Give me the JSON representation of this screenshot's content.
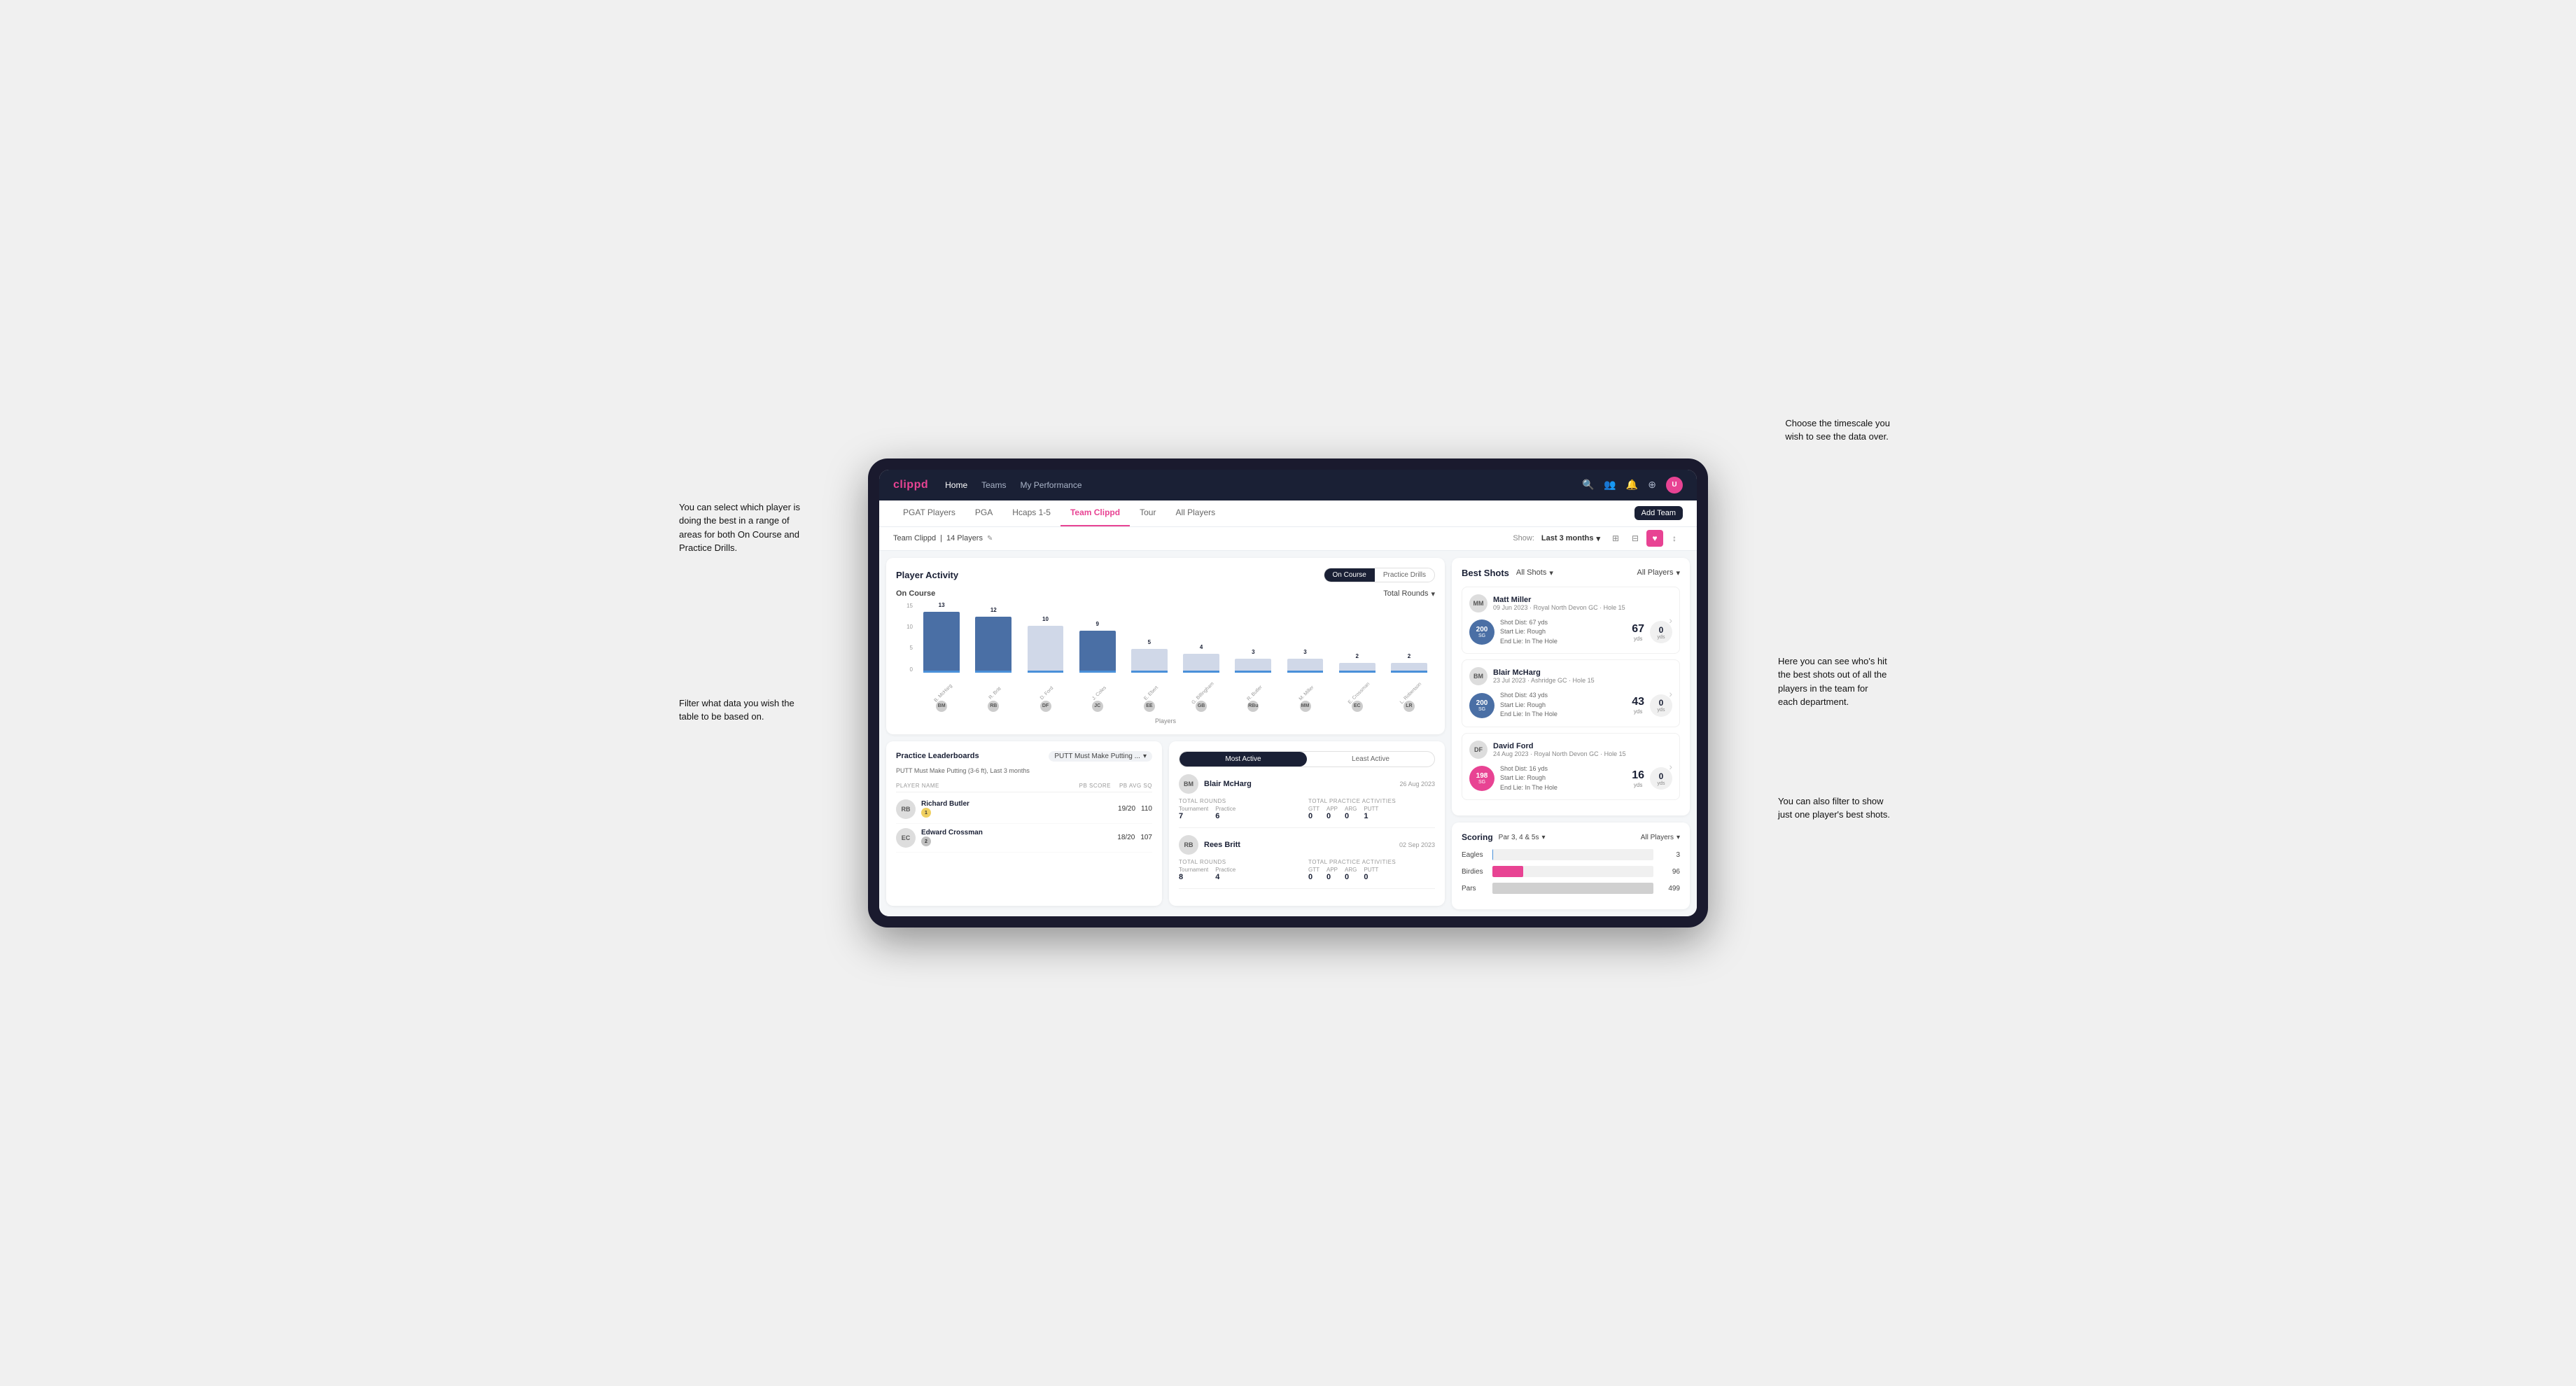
{
  "annotations": {
    "top_right": "Choose the timescale you\nwish to see the data over.",
    "left_top": "You can select which player is\ndoing the best in a range of\nareas for both On Course and\nPractice Drills.",
    "left_bottom": "Filter what data you wish the\ntable to be based on.",
    "right_bottom": "Here you can see who's hit\nthe best shots out of all the\nplayers in the team for\neach department.",
    "right_bottom2": "You can also filter to show\njust one player's best shots."
  },
  "nav": {
    "logo": "clippd",
    "links": [
      "Home",
      "Teams",
      "My Performance"
    ],
    "icons": [
      "🔍",
      "👤",
      "🔔",
      "⊕",
      "👤"
    ]
  },
  "sub_nav": {
    "tabs": [
      "PGAT Players",
      "PGA",
      "Hcaps 1-5",
      "Team Clippd",
      "Tour",
      "All Players"
    ],
    "active": "Team Clippd",
    "add_button": "Add Team"
  },
  "team_header": {
    "title": "Team Clippd",
    "player_count": "14 Players",
    "show_label": "Show:",
    "show_value": "Last 3 months",
    "view_icons": [
      "⊞",
      "⊟",
      "♥",
      "↕"
    ]
  },
  "player_activity": {
    "title": "Player Activity",
    "toggle_options": [
      "On Course",
      "Practice Drills"
    ],
    "active_toggle": "On Course",
    "chart_label": "On Course",
    "filter_label": "Total Rounds",
    "y_axis": [
      "15",
      "10",
      "5",
      "0"
    ],
    "bars": [
      {
        "name": "B. McHarg",
        "value": 13,
        "initials": "BM",
        "highlighted": true
      },
      {
        "name": "R. Britt",
        "value": 12,
        "initials": "RB",
        "highlighted": true
      },
      {
        "name": "D. Ford",
        "value": 10,
        "initials": "DF"
      },
      {
        "name": "J. Coles",
        "value": 9,
        "initials": "JC",
        "highlighted": true
      },
      {
        "name": "E. Ebert",
        "value": 5,
        "initials": "EE"
      },
      {
        "name": "G. Billingham",
        "value": 4,
        "initials": "GB"
      },
      {
        "name": "R. Butler",
        "value": 3,
        "initials": "RBu"
      },
      {
        "name": "M. Miller",
        "value": 3,
        "initials": "MM"
      },
      {
        "name": "E. Crossman",
        "value": 2,
        "initials": "EC"
      },
      {
        "name": "L. Robertson",
        "value": 2,
        "initials": "LR"
      }
    ],
    "x_label": "Players"
  },
  "best_shots": {
    "title": "Best Shots",
    "filter_shots": "All Shots",
    "filter_players": "All Players",
    "players": [
      {
        "name": "Matt Miller",
        "date": "09 Jun 2023",
        "course": "Royal North Devon GC",
        "hole": "Hole 15",
        "badge_val": "200",
        "badge_sub": "SG",
        "badge_color": "blue",
        "shot_dist": "Shot Dist: 67 yds",
        "start_lie": "Start Lie: Rough",
        "end_lie": "End Lie: In The Hole",
        "stat1_val": "67",
        "stat1_unit": "yds",
        "stat2_val": "0",
        "stat2_unit": "yds"
      },
      {
        "name": "Blair McHarg",
        "date": "23 Jul 2023",
        "course": "Ashridge GC",
        "hole": "Hole 15",
        "badge_val": "200",
        "badge_sub": "SG",
        "badge_color": "blue",
        "shot_dist": "Shot Dist: 43 yds",
        "start_lie": "Start Lie: Rough",
        "end_lie": "End Lie: In The Hole",
        "stat1_val": "43",
        "stat1_unit": "yds",
        "stat2_val": "0",
        "stat2_unit": "yds"
      },
      {
        "name": "David Ford",
        "date": "24 Aug 2023",
        "course": "Royal North Devon GC",
        "hole": "Hole 15",
        "badge_val": "198",
        "badge_sub": "SG",
        "badge_color": "red",
        "shot_dist": "Shot Dist: 16 yds",
        "start_lie": "Start Lie: Rough",
        "end_lie": "End Lie: In The Hole",
        "stat1_val": "16",
        "stat1_unit": "yds",
        "stat2_val": "0",
        "stat2_unit": "yds"
      }
    ]
  },
  "practice_leaderboard": {
    "title": "Practice Leaderboards",
    "filter": "PUTT Must Make Putting ...",
    "subtitle": "PUTT Must Make Putting (3-6 ft), Last 3 months",
    "columns": [
      "PLAYER NAME",
      "PB SCORE",
      "PB AVG SQ"
    ],
    "players": [
      {
        "name": "Richard Butler",
        "rank": 1,
        "score": "19/20",
        "avg": "110",
        "initials": "RB"
      },
      {
        "name": "Edward Crossman",
        "rank": 2,
        "score": "18/20",
        "avg": "107",
        "initials": "EC"
      }
    ]
  },
  "most_active": {
    "tabs": [
      "Most Active",
      "Least Active"
    ],
    "active_tab": "Most Active",
    "players": [
      {
        "name": "Blair McHarg",
        "date": "26 Aug 2023",
        "initials": "BM",
        "total_rounds_label": "Total Rounds",
        "tournament": "7",
        "practice": "6",
        "practice_activities_label": "Total Practice Activities",
        "gtt": "0",
        "app": "0",
        "arg": "0",
        "putt": "1"
      },
      {
        "name": "Rees Britt",
        "date": "02 Sep 2023",
        "initials": "RB",
        "total_rounds_label": "Total Rounds",
        "tournament": "8",
        "practice": "4",
        "practice_activities_label": "Total Practice Activities",
        "gtt": "0",
        "app": "0",
        "arg": "0",
        "putt": "0"
      }
    ]
  },
  "scoring": {
    "title": "Scoring",
    "filter_par": "Par 3, 4 & 5s",
    "filter_players": "All Players",
    "bars": [
      {
        "label": "Eagles",
        "value": 3,
        "max": 500,
        "color": "eagles"
      },
      {
        "label": "Birdies",
        "value": 96,
        "max": 500,
        "color": "birdies"
      },
      {
        "label": "Pars",
        "value": 499,
        "max": 500,
        "color": "pars"
      }
    ]
  },
  "colors": {
    "brand": "#e84393",
    "dark_nav": "#1a2035",
    "accent_blue": "#4a6fa5",
    "light_bg": "#f4f6f8"
  }
}
